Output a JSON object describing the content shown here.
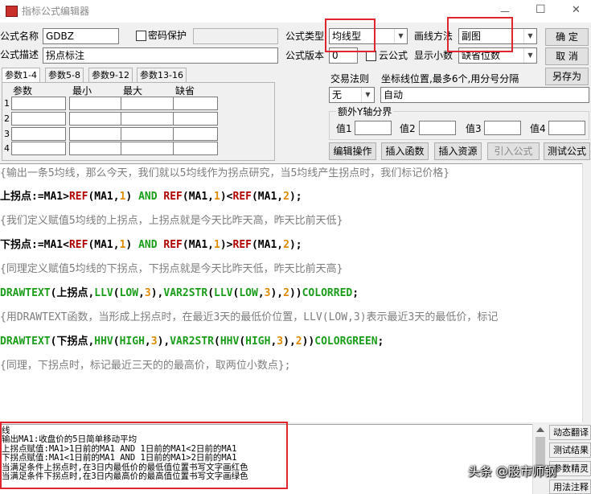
{
  "window": {
    "title": "指标公式编辑器",
    "minimize_glyph": "—",
    "maximize_glyph": "☐",
    "close_glyph": "✕"
  },
  "form": {
    "name_label": "公式名称",
    "name_value": "GDBZ",
    "password_label": "密码保护",
    "desc_label": "公式描述",
    "desc_value": "拐点标注",
    "type_label": "公式类型",
    "type_value": "均线型",
    "draw_label": "画线方法",
    "draw_value": "副图",
    "version_label": "公式版本",
    "version_value": "0",
    "cloud_label": "云公式",
    "decimals_label": "显示小数",
    "decimals_value": "缺省位数"
  },
  "buttons": {
    "ok": "确  定",
    "cancel": "取  消",
    "save_as": "另存为",
    "edit_ops": "编辑操作",
    "insert_func": "插入函数",
    "insert_res": "插入资源",
    "import_formula": "引入公式",
    "test_formula": "测试公式"
  },
  "tabs": [
    "参数1-4",
    "参数5-8",
    "参数9-12",
    "参数13-16"
  ],
  "params": {
    "headers": [
      "参数",
      "最小",
      "最大",
      "缺省"
    ],
    "rows": [
      "1",
      "2",
      "3",
      "4"
    ]
  },
  "trade": {
    "rule_label": "交易法则",
    "rule_value": "无",
    "coord_label": "坐标线位置,最多6个,用分号分隔",
    "coord_value": "自动",
    "yaxis_label": "额外Y轴分界",
    "values": [
      "值1",
      "值2",
      "值3",
      "值4"
    ]
  },
  "code": {
    "c1": "{输出一条5均线，那么今天，我们就以5均线作为拐点研究，当5均线产生拐点时，我们标记价格}",
    "l2": [
      [
        "上拐点:=MA1>",
        "plain"
      ],
      [
        "REF",
        "fn"
      ],
      [
        "(MA1,",
        "plain"
      ],
      [
        "1",
        "num"
      ],
      [
        ") ",
        "plain"
      ],
      [
        "AND",
        "kw"
      ],
      [
        " ",
        "plain"
      ],
      [
        "REF",
        "fn"
      ],
      [
        "(MA1,",
        "plain"
      ],
      [
        "1",
        "num"
      ],
      [
        ")<",
        "plain"
      ],
      [
        "REF",
        "fn"
      ],
      [
        "(MA1,",
        "plain"
      ],
      [
        "2",
        "num"
      ],
      [
        ");",
        "plain"
      ]
    ],
    "c3": "{我们定义赋值5均线的上拐点，上拐点就是今天比昨天高，昨天比前天低}",
    "l4": [
      [
        "下拐点:=MA1<",
        "plain"
      ],
      [
        "REF",
        "fn"
      ],
      [
        "(MA1,",
        "plain"
      ],
      [
        "1",
        "num"
      ],
      [
        ") ",
        "plain"
      ],
      [
        "AND",
        "kw"
      ],
      [
        " ",
        "plain"
      ],
      [
        "REF",
        "fn"
      ],
      [
        "(MA1,",
        "plain"
      ],
      [
        "1",
        "num"
      ],
      [
        ")>",
        "plain"
      ],
      [
        "REF",
        "fn"
      ],
      [
        "(MA1,",
        "plain"
      ],
      [
        "2",
        "num"
      ],
      [
        ");",
        "plain"
      ]
    ],
    "c5": "{同理定义赋值5均线的下拐点，下拐点就是今天比昨天低，昨天比前天高}",
    "l6": [
      [
        "DRAWTEXT",
        "kw"
      ],
      [
        "(上拐点,",
        "plain"
      ],
      [
        "LLV",
        "kw"
      ],
      [
        "(",
        "plain"
      ],
      [
        "LOW",
        "kw"
      ],
      [
        ",",
        "plain"
      ],
      [
        "3",
        "num"
      ],
      [
        "),",
        "plain"
      ],
      [
        "VAR2STR",
        "kw"
      ],
      [
        "(",
        "plain"
      ],
      [
        "LLV",
        "kw"
      ],
      [
        "(",
        "plain"
      ],
      [
        "LOW",
        "kw"
      ],
      [
        ",",
        "plain"
      ],
      [
        "3",
        "num"
      ],
      [
        "),",
        "plain"
      ],
      [
        "2",
        "num"
      ],
      [
        "))",
        "plain"
      ],
      [
        "COLORRED",
        "kw"
      ],
      [
        ";",
        "plain"
      ]
    ],
    "c7": "{用DRAWTEXT函数，当形成上拐点时，在最近3天的最低价位置，LLV(LOW,3)表示最近3天的最低价，标记",
    "l8": [
      [
        "DRAWTEXT",
        "kw"
      ],
      [
        "(下拐点,",
        "plain"
      ],
      [
        "HHV",
        "kw"
      ],
      [
        "(",
        "plain"
      ],
      [
        "HIGH",
        "kw"
      ],
      [
        ",",
        "plain"
      ],
      [
        "3",
        "num"
      ],
      [
        "),",
        "plain"
      ],
      [
        "VAR2STR",
        "kw"
      ],
      [
        "(",
        "plain"
      ],
      [
        "HHV",
        "kw"
      ],
      [
        "(",
        "plain"
      ],
      [
        "HIGH",
        "kw"
      ],
      [
        ",",
        "plain"
      ],
      [
        "3",
        "num"
      ],
      [
        "),",
        "plain"
      ],
      [
        "2",
        "num"
      ],
      [
        "))",
        "plain"
      ],
      [
        "COLORGREEN",
        "kw"
      ],
      [
        ";",
        "plain"
      ]
    ],
    "c9": "{同理，下拐点时，标记最近三天的的最高价，取两位小数点};"
  },
  "output": {
    "lines": [
      "线",
      "输出MA1:收盘价的5日简单移动平均",
      "上拐点赋值:MA1>1日前的MA1 AND 1日前的MA1<2日前的MA1",
      "下拐点赋值:MA1<1日前的MA1 AND 1日前的MA1>2日前的MA1",
      "当满足条件上拐点时,在3日内最低价的最低值位置书写文字画红色",
      "当满足条件下拐点时,在3日内最高价的最高值位置书写文字画绿色"
    ]
  },
  "side_buttons": [
    "动态翻译",
    "测试结果",
    "参数精灵",
    "用法注释"
  ],
  "watermark": "头条 @股市师钢"
}
